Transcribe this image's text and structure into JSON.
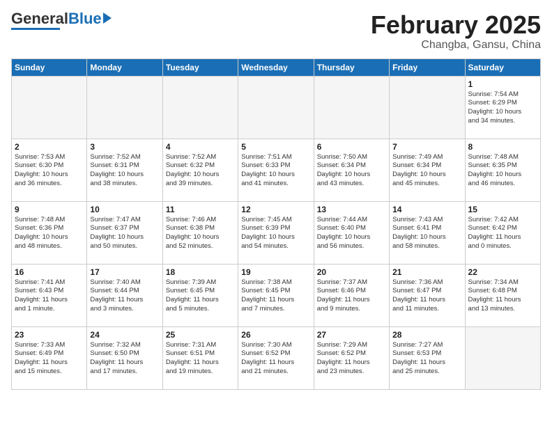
{
  "header": {
    "logo_text_general": "General",
    "logo_text_blue": "Blue",
    "month": "February 2025",
    "location": "Changba, Gansu, China"
  },
  "weekdays": [
    "Sunday",
    "Monday",
    "Tuesday",
    "Wednesday",
    "Thursday",
    "Friday",
    "Saturday"
  ],
  "weeks": [
    [
      {
        "day": "",
        "info": ""
      },
      {
        "day": "",
        "info": ""
      },
      {
        "day": "",
        "info": ""
      },
      {
        "day": "",
        "info": ""
      },
      {
        "day": "",
        "info": ""
      },
      {
        "day": "",
        "info": ""
      },
      {
        "day": "1",
        "info": "Sunrise: 7:54 AM\nSunset: 6:29 PM\nDaylight: 10 hours\nand 34 minutes."
      }
    ],
    [
      {
        "day": "2",
        "info": "Sunrise: 7:53 AM\nSunset: 6:30 PM\nDaylight: 10 hours\nand 36 minutes."
      },
      {
        "day": "3",
        "info": "Sunrise: 7:52 AM\nSunset: 6:31 PM\nDaylight: 10 hours\nand 38 minutes."
      },
      {
        "day": "4",
        "info": "Sunrise: 7:52 AM\nSunset: 6:32 PM\nDaylight: 10 hours\nand 39 minutes."
      },
      {
        "day": "5",
        "info": "Sunrise: 7:51 AM\nSunset: 6:33 PM\nDaylight: 10 hours\nand 41 minutes."
      },
      {
        "day": "6",
        "info": "Sunrise: 7:50 AM\nSunset: 6:34 PM\nDaylight: 10 hours\nand 43 minutes."
      },
      {
        "day": "7",
        "info": "Sunrise: 7:49 AM\nSunset: 6:34 PM\nDaylight: 10 hours\nand 45 minutes."
      },
      {
        "day": "8",
        "info": "Sunrise: 7:48 AM\nSunset: 6:35 PM\nDaylight: 10 hours\nand 46 minutes."
      }
    ],
    [
      {
        "day": "9",
        "info": "Sunrise: 7:48 AM\nSunset: 6:36 PM\nDaylight: 10 hours\nand 48 minutes."
      },
      {
        "day": "10",
        "info": "Sunrise: 7:47 AM\nSunset: 6:37 PM\nDaylight: 10 hours\nand 50 minutes."
      },
      {
        "day": "11",
        "info": "Sunrise: 7:46 AM\nSunset: 6:38 PM\nDaylight: 10 hours\nand 52 minutes."
      },
      {
        "day": "12",
        "info": "Sunrise: 7:45 AM\nSunset: 6:39 PM\nDaylight: 10 hours\nand 54 minutes."
      },
      {
        "day": "13",
        "info": "Sunrise: 7:44 AM\nSunset: 6:40 PM\nDaylight: 10 hours\nand 56 minutes."
      },
      {
        "day": "14",
        "info": "Sunrise: 7:43 AM\nSunset: 6:41 PM\nDaylight: 10 hours\nand 58 minutes."
      },
      {
        "day": "15",
        "info": "Sunrise: 7:42 AM\nSunset: 6:42 PM\nDaylight: 11 hours\nand 0 minutes."
      }
    ],
    [
      {
        "day": "16",
        "info": "Sunrise: 7:41 AM\nSunset: 6:43 PM\nDaylight: 11 hours\nand 1 minute."
      },
      {
        "day": "17",
        "info": "Sunrise: 7:40 AM\nSunset: 6:44 PM\nDaylight: 11 hours\nand 3 minutes."
      },
      {
        "day": "18",
        "info": "Sunrise: 7:39 AM\nSunset: 6:45 PM\nDaylight: 11 hours\nand 5 minutes."
      },
      {
        "day": "19",
        "info": "Sunrise: 7:38 AM\nSunset: 6:45 PM\nDaylight: 11 hours\nand 7 minutes."
      },
      {
        "day": "20",
        "info": "Sunrise: 7:37 AM\nSunset: 6:46 PM\nDaylight: 11 hours\nand 9 minutes."
      },
      {
        "day": "21",
        "info": "Sunrise: 7:36 AM\nSunset: 6:47 PM\nDaylight: 11 hours\nand 11 minutes."
      },
      {
        "day": "22",
        "info": "Sunrise: 7:34 AM\nSunset: 6:48 PM\nDaylight: 11 hours\nand 13 minutes."
      }
    ],
    [
      {
        "day": "23",
        "info": "Sunrise: 7:33 AM\nSunset: 6:49 PM\nDaylight: 11 hours\nand 15 minutes."
      },
      {
        "day": "24",
        "info": "Sunrise: 7:32 AM\nSunset: 6:50 PM\nDaylight: 11 hours\nand 17 minutes."
      },
      {
        "day": "25",
        "info": "Sunrise: 7:31 AM\nSunset: 6:51 PM\nDaylight: 11 hours\nand 19 minutes."
      },
      {
        "day": "26",
        "info": "Sunrise: 7:30 AM\nSunset: 6:52 PM\nDaylight: 11 hours\nand 21 minutes."
      },
      {
        "day": "27",
        "info": "Sunrise: 7:29 AM\nSunset: 6:52 PM\nDaylight: 11 hours\nand 23 minutes."
      },
      {
        "day": "28",
        "info": "Sunrise: 7:27 AM\nSunset: 6:53 PM\nDaylight: 11 hours\nand 25 minutes."
      },
      {
        "day": "",
        "info": ""
      }
    ]
  ]
}
